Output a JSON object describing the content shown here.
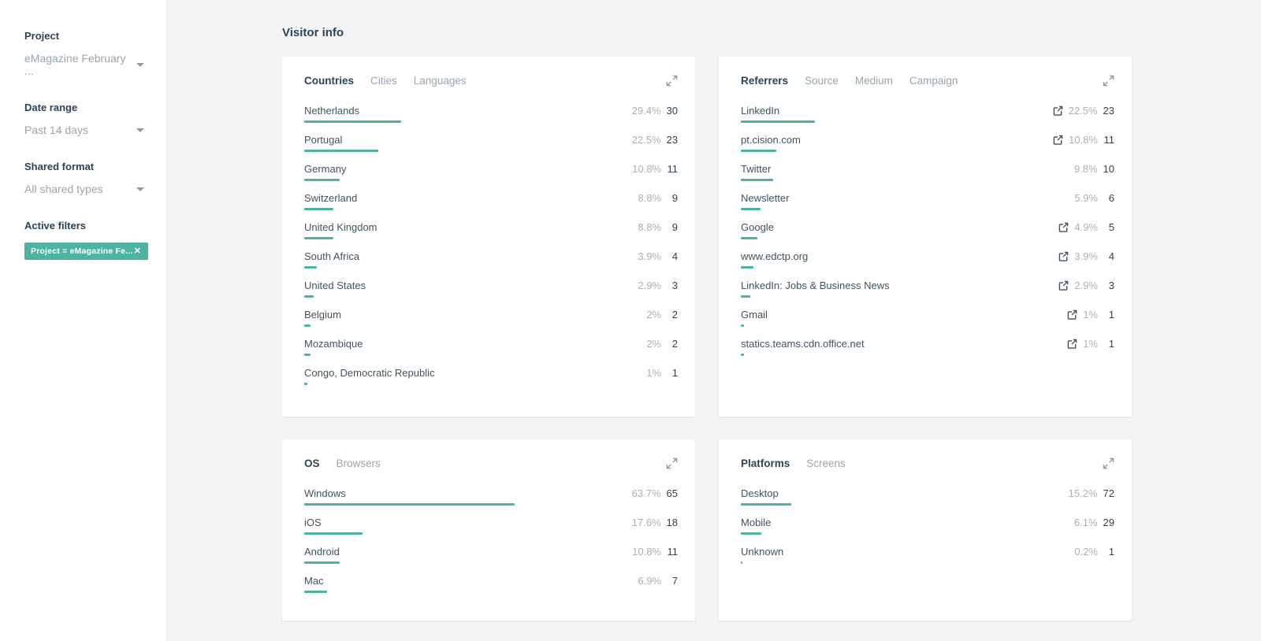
{
  "page_title": "Visitor info",
  "sidebar": {
    "sections": [
      {
        "label": "Project",
        "value": "eMagazine February ..."
      },
      {
        "label": "Date range",
        "value": "Past 14 days"
      },
      {
        "label": "Shared format",
        "value": "All shared types"
      }
    ],
    "active_filters_label": "Active filters",
    "filter_chip": {
      "text": "Project = eMagazine Fe...",
      "close": "✕"
    }
  },
  "colors": {
    "accent_teal": "#4fb3a1",
    "heading": "#2c4356",
    "muted_text": "#9aa5ac",
    "background": "#f3f4f6"
  },
  "cards": [
    {
      "id": "visitor-countries",
      "tabs": [
        {
          "label": "Countries",
          "active": true
        },
        {
          "label": "Cities",
          "active": false
        },
        {
          "label": "Languages",
          "active": false
        }
      ],
      "rows": [
        {
          "label": "Netherlands",
          "pct": "29.4%",
          "count": "30",
          "bar": 29.4,
          "external": false
        },
        {
          "label": "Portugal",
          "pct": "22.5%",
          "count": "23",
          "bar": 22.5,
          "external": false
        },
        {
          "label": "Germany",
          "pct": "10.8%",
          "count": "11",
          "bar": 10.8,
          "external": false
        },
        {
          "label": "Switzerland",
          "pct": "8.8%",
          "count": "9",
          "bar": 8.8,
          "external": false
        },
        {
          "label": "United Kingdom",
          "pct": "8.8%",
          "count": "9",
          "bar": 8.8,
          "external": false
        },
        {
          "label": "South Africa",
          "pct": "3.9%",
          "count": "4",
          "bar": 3.9,
          "external": false
        },
        {
          "label": "United States",
          "pct": "2.9%",
          "count": "3",
          "bar": 2.9,
          "external": false
        },
        {
          "label": "Belgium",
          "pct": "2%",
          "count": "2",
          "bar": 2,
          "external": false
        },
        {
          "label": "Mozambique",
          "pct": "2%",
          "count": "2",
          "bar": 2,
          "external": false
        },
        {
          "label": "Congo, Democratic Republic",
          "pct": "1%",
          "count": "1",
          "bar": 1,
          "external": false
        }
      ]
    },
    {
      "id": "traffic-referrers",
      "tabs": [
        {
          "label": "Referrers",
          "active": true
        },
        {
          "label": "Source",
          "active": false
        },
        {
          "label": "Medium",
          "active": false
        },
        {
          "label": "Campaign",
          "active": false
        }
      ],
      "rows": [
        {
          "label": "LinkedIn",
          "pct": "22.5%",
          "count": "23",
          "bar": 22.5,
          "external": true
        },
        {
          "label": "pt.cision.com",
          "pct": "10.8%",
          "count": "11",
          "bar": 10.8,
          "external": true
        },
        {
          "label": "Twitter",
          "pct": "9.8%",
          "count": "10",
          "bar": 9.8,
          "external": false
        },
        {
          "label": "Newsletter",
          "pct": "5.9%",
          "count": "6",
          "bar": 5.9,
          "external": false
        },
        {
          "label": "Google",
          "pct": "4.9%",
          "count": "5",
          "bar": 4.9,
          "external": true
        },
        {
          "label": "www.edctp.org",
          "pct": "3.9%",
          "count": "4",
          "bar": 3.9,
          "external": true
        },
        {
          "label": "LinkedIn: Jobs & Business News",
          "pct": "2.9%",
          "count": "3",
          "bar": 2.9,
          "external": true
        },
        {
          "label": "Gmail",
          "pct": "1%",
          "count": "1",
          "bar": 1,
          "external": true
        },
        {
          "label": "statics.teams.cdn.office.net",
          "pct": "1%",
          "count": "1",
          "bar": 1,
          "external": true
        }
      ]
    },
    {
      "id": "visitor-os",
      "tabs": [
        {
          "label": "OS",
          "active": true
        },
        {
          "label": "Browsers",
          "active": false
        }
      ],
      "rows": [
        {
          "label": "Windows",
          "pct": "63.7%",
          "count": "65",
          "bar": 63.7,
          "external": false
        },
        {
          "label": "iOS",
          "pct": "17.6%",
          "count": "18",
          "bar": 17.6,
          "external": false
        },
        {
          "label": "Android",
          "pct": "10.8%",
          "count": "11",
          "bar": 10.8,
          "external": false
        },
        {
          "label": "Mac",
          "pct": "6.9%",
          "count": "7",
          "bar": 6.9,
          "external": false
        }
      ]
    },
    {
      "id": "visitor-platforms",
      "tabs": [
        {
          "label": "Platforms",
          "active": true
        },
        {
          "label": "Screens",
          "active": false
        }
      ],
      "rows": [
        {
          "label": "Desktop",
          "pct": "15.2%",
          "count": "72",
          "bar": 15.2,
          "external": false
        },
        {
          "label": "Mobile",
          "pct": "6.1%",
          "count": "29",
          "bar": 6.1,
          "external": false
        },
        {
          "label": "Unknown",
          "pct": "0.2%",
          "count": "1",
          "bar": 0.2,
          "external": false
        }
      ]
    }
  ]
}
